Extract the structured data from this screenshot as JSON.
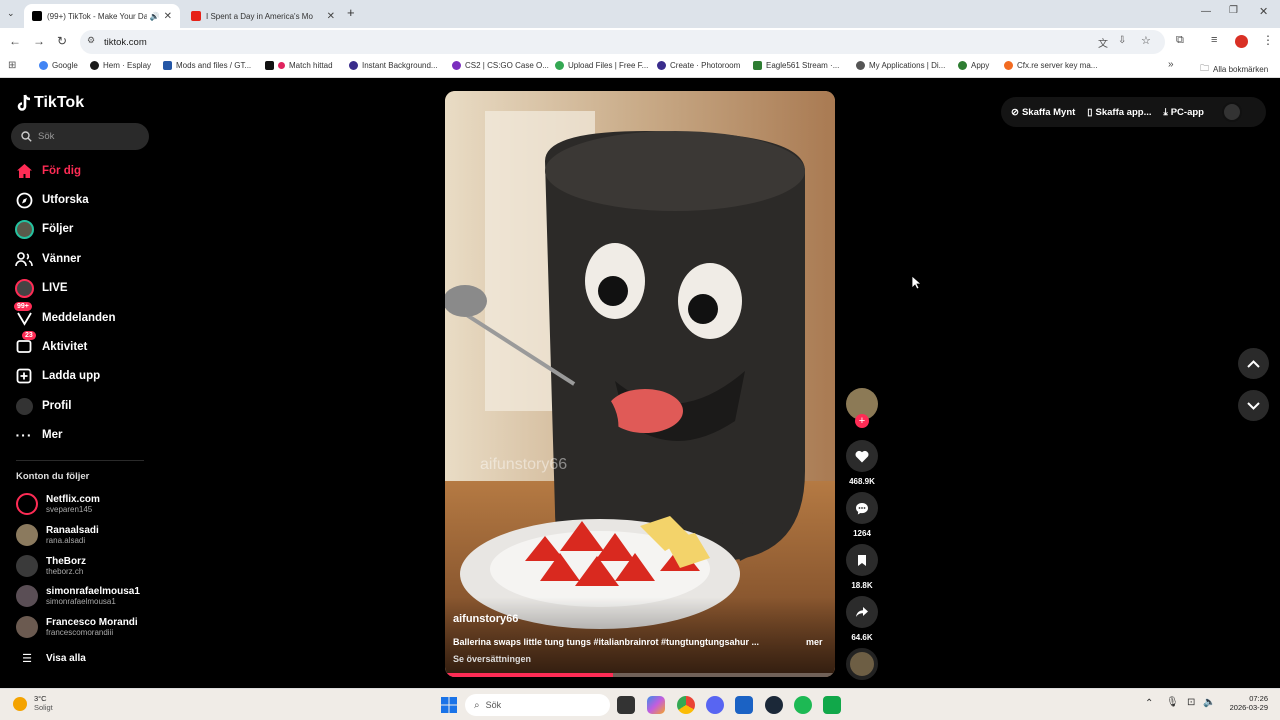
{
  "browser": {
    "tabs": [
      {
        "title": "(99+) TikTok - Make Your Da",
        "active": true
      },
      {
        "title": "I Spent a Day in America's Mo",
        "active": false
      }
    ],
    "url": "tiktok.com",
    "bookmarks": [
      "Google",
      "Hem · Esplay",
      "Mods and files / GT...",
      "Match hittad",
      "Instant Background...",
      "CS2 | CS:GO Case O...",
      "Upload Files | Free F...",
      "Create · Photoroom",
      "Eagle561 Stream ·...",
      "My Applications | Di...",
      "Appy",
      "Cfx.re server key ma..."
    ],
    "all_bookmarks": "Alla bokmärken"
  },
  "tiktok": {
    "logo": "TikTok",
    "search_placeholder": "Sök",
    "nav": [
      {
        "label": "För dig",
        "icon": "home-icon",
        "active": true
      },
      {
        "label": "Utforska",
        "icon": "compass-icon"
      },
      {
        "label": "Följer",
        "icon": "following-avatar-icon"
      },
      {
        "label": "Vänner",
        "icon": "friends-icon"
      },
      {
        "label": "LIVE",
        "icon": "live-icon"
      },
      {
        "label": "Meddelanden",
        "icon": "messages-icon",
        "badge": "99+"
      },
      {
        "label": "Aktivitet",
        "icon": "activity-icon",
        "badge": "23"
      },
      {
        "label": "Ladda upp",
        "icon": "upload-icon"
      },
      {
        "label": "Profil",
        "icon": "profile-icon"
      },
      {
        "label": "Mer",
        "icon": "more-icon"
      }
    ],
    "following_title": "Konton du följer",
    "accounts": [
      {
        "name": "Netflix.com",
        "user": "sveparen145"
      },
      {
        "name": "Ranaalsadi",
        "user": "rana.alsadi"
      },
      {
        "name": "TheBorz",
        "user": "theborz.ch"
      },
      {
        "name": "simonrafaelmousa1",
        "user": "simonrafaelmousa1"
      },
      {
        "name": "Francesco Morandi",
        "user": "francescomorandiii"
      }
    ],
    "show_all": "Visa alla",
    "top_buttons": {
      "coins": "Skaffa Mynt",
      "app": "Skaffa app...",
      "pc": "PC-app"
    },
    "video": {
      "watermark": "aifunstory66",
      "author": "aifunstory66",
      "caption": "Ballerina swaps little tung tungs #italianbrainrot #tungtungtungsahur ...",
      "more": "mer",
      "translate": "Se översättningen",
      "progress": 0.43
    },
    "actions": {
      "likes": "468.9K",
      "comments": "1264",
      "saves": "18.8K",
      "shares": "64.6K"
    }
  },
  "taskbar": {
    "weather_temp": "3°C",
    "weather_desc": "Soligt",
    "search": "Sök",
    "time": "07:26",
    "date": "2026-03-29"
  },
  "colors": {
    "accent": "#fe2c55",
    "bg": "#000000"
  }
}
